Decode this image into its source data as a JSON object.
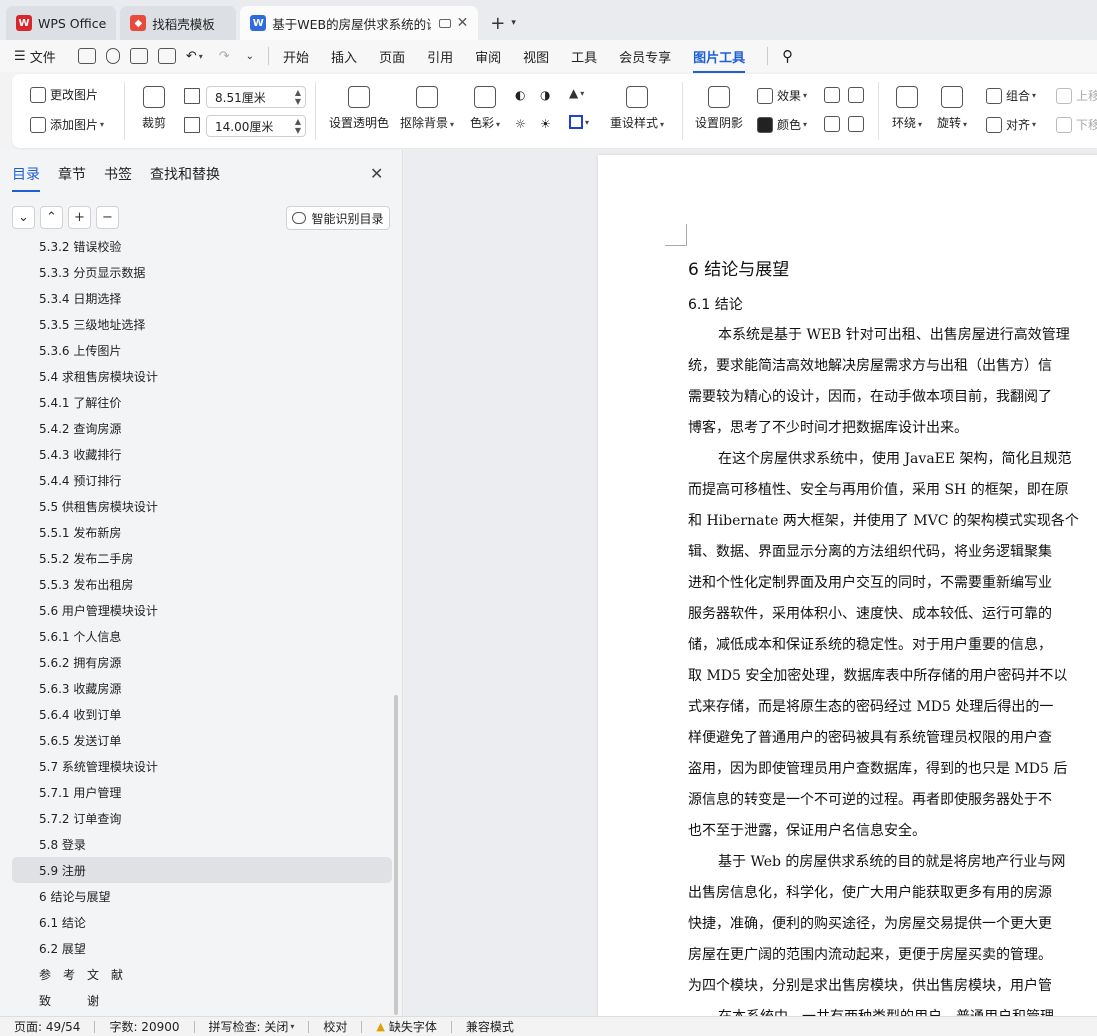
{
  "tabs": [
    {
      "label": "WPS Office",
      "icon": "wps-logo-icon",
      "color": "#d9262c"
    },
    {
      "label": "找稻壳模板",
      "icon": "docer-icon",
      "color": "#e84a3c"
    },
    {
      "label": "基于WEB的房屋供求系统的设",
      "icon": "word-doc-icon",
      "color": "#2f6bdc"
    }
  ],
  "menu": {
    "file": "文件",
    "items": [
      "开始",
      "插入",
      "页面",
      "引用",
      "审阅",
      "视图",
      "工具",
      "会员专享",
      "图片工具"
    ],
    "selected": "图片工具"
  },
  "ribbon": {
    "change_image": "更改图片",
    "add_image": "添加图片",
    "crop": "裁剪",
    "width": "8.51厘米",
    "height": "14.00厘米",
    "set_transparent": "设置透明色",
    "remove_bg": "抠除背景",
    "color": "色彩",
    "reset_style": "重设样式",
    "set_shadow": "设置阴影",
    "effect": "效果",
    "color2": "颜色",
    "wrap": "环绕",
    "rotate": "旋转",
    "group": "组合",
    "align": "对齐",
    "up": "上移",
    "down": "下移"
  },
  "nav": {
    "tabs": [
      "目录",
      "章节",
      "书签",
      "查找和替换"
    ],
    "smart_btn": "智能识别目录",
    "toc": [
      "5.3.2 错误校验",
      "5.3.3 分页显示数据",
      "5.3.4 日期选择",
      "5.3.5 三级地址选择",
      "5.3.6 上传图片",
      "5.4 求租售房模块设计",
      "5.4.1 了解往价",
      "5.4.2 查询房源",
      "5.4.3 收藏排行",
      "5.4.4 预订排行",
      "5.5 供租售房模块设计",
      "5.5.1 发布新房",
      "5.5.2 发布二手房",
      "5.5.3 发布出租房",
      "5.6 用户管理模块设计",
      "5.6.1 个人信息",
      "5.6.2 拥有房源",
      "5.6.3 收藏房源",
      "5.6.4 收到订单",
      "5.6.5 发送订单",
      "5.7 系统管理模块设计",
      "5.7.1 用户管理",
      "5.7.2 订单查询",
      "5.8 登录",
      "5.9 注册",
      "6 结论与展望",
      "6.1 结论",
      "6.2 展望",
      "参　考　文　献",
      "致　　　谢"
    ],
    "selected_index": 24
  },
  "document": {
    "heading1": "6  结论与展望",
    "heading2": "6.1  结论",
    "lines": [
      "本系统是基于 WEB 针对可出租、出售房屋进行高效管理",
      "统，要求能简洁高效地解决房屋需求方与出租（出售方）信",
      "需要较为精心的设计，因而，在动手做本项目前，我翻阅了",
      "博客，思考了不少时间才把数据库设计出来。",
      "在这个房屋供求系统中，使用 JavaEE 架构，简化且规范",
      "而提高可移植性、安全与再用价值，采用 SH 的框架，即在原",
      "和  Hibernate 两大框架，并使用了 MVC 的架构模式实现各个",
      "辑、数据、界面显示分离的方法组织代码，将业务逻辑聚集",
      "进和个性化定制界面及用户交互的同时，不需要重新编写业",
      "服务器软件，采用体积小、速度快、成本较低、运行可靠的",
      "储，减低成本和保证系统的稳定性。对于用户重要的信息，",
      "取 MD5 安全加密处理，数据库表中所存储的用户密码并不以",
      "式来存储，而是将原生态的密码经过 MD5 处理后得出的一",
      "样便避免了普通用户的密码被具有系统管理员权限的用户查",
      "盗用，因为即使管理员用户查数据库，得到的也只是 MD5 后",
      "源信息的转变是一个不可逆的过程。再者即使服务器处于不",
      "也不至于泄露，保证用户名信息安全。",
      "基于 Web 的房屋供求系统的目的就是将房地产行业与网",
      "出售房信息化，科学化，使广大用户能获取更多有用的房源",
      "快捷，准确，便利的购买途径，为房屋交易提供一个更大更",
      "房屋在更广阔的范围内流动起来，更便于房屋买卖的管理。",
      "为四个模块，分别是求出售房模块，供出售房模块，用户管",
      "在本系统中，一共有两种类型的用户，普通用户和管理"
    ],
    "indented": [
      0,
      4,
      17,
      22
    ]
  },
  "status": {
    "page": "页面: 49/54",
    "words": "字数: 20900",
    "spell": "拼写检查: 关闭",
    "proof": "校对",
    "missing_font": "缺失字体",
    "compat": "兼容模式"
  }
}
